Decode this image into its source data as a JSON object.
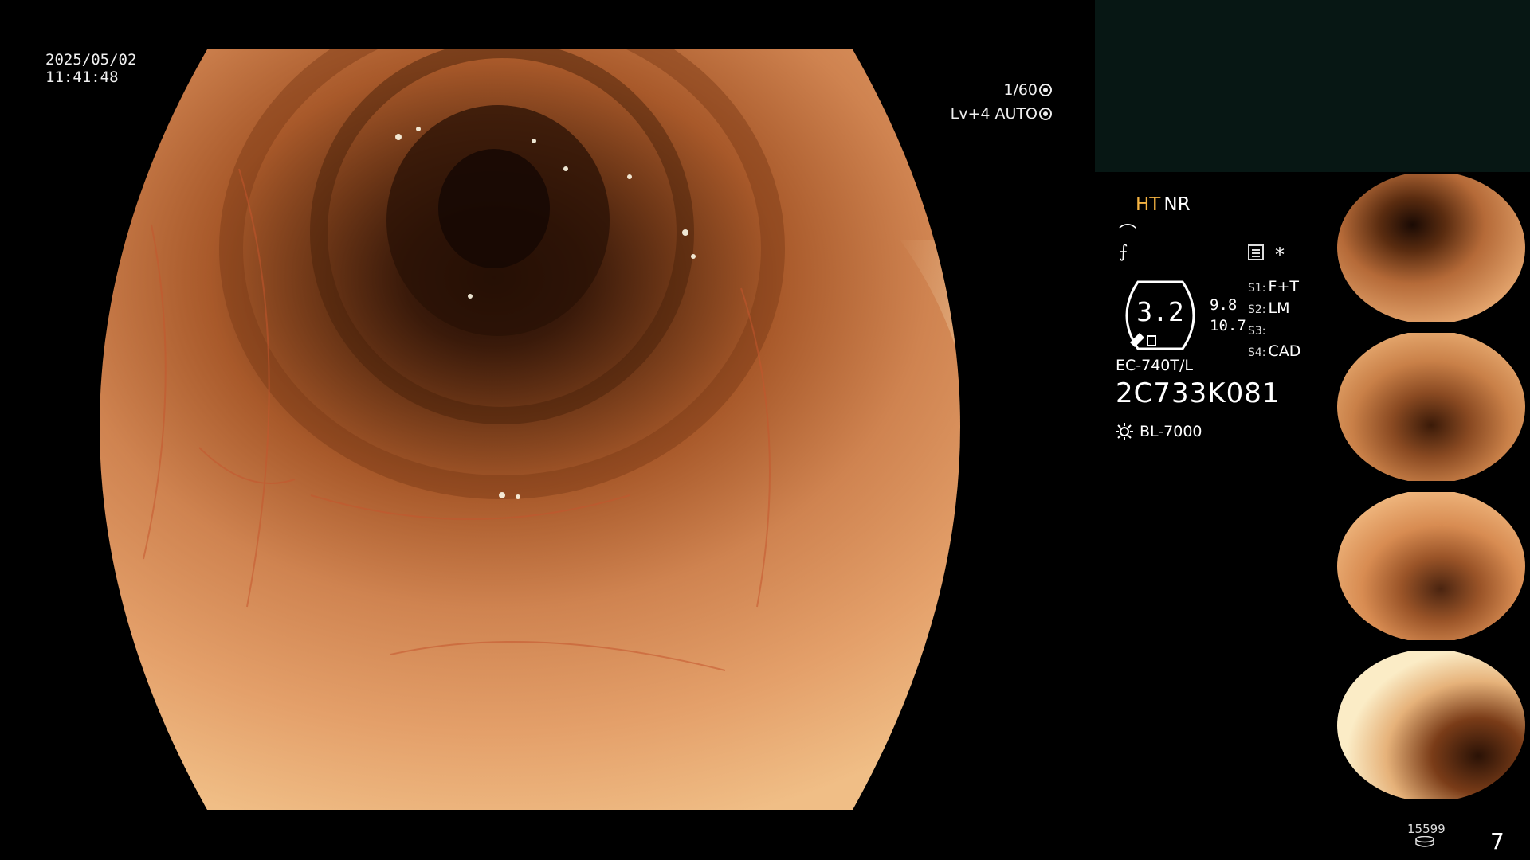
{
  "header": {
    "date": "2025/05/02",
    "time": "11:41:48"
  },
  "exposure": {
    "shutter": "1/60",
    "level": "Lv+4",
    "mode": "AUTO"
  },
  "info": {
    "enhance_ht": "HT",
    "enhance_nr": "NR",
    "main_value": "3.2",
    "sub_value_1": "9.8",
    "sub_value_2": "10.7",
    "asterisk": "*",
    "slots": [
      {
        "key": "S1:",
        "value": "F+T"
      },
      {
        "key": "S2:",
        "value": "LM"
      },
      {
        "key": "S3:",
        "value": ""
      },
      {
        "key": "S4:",
        "value": "CAD"
      }
    ],
    "scope_model": "EC-740T/L",
    "scope_serial": "2C733K081",
    "light_source": "BL-7000"
  },
  "icons": [
    "shutter-icon",
    "auto-iris-icon",
    "structure-enhance-icon",
    "freeze-icon",
    "memo-icon",
    "light-source-icon",
    "storage-disk-icon"
  ],
  "footer": {
    "image_count": "15599",
    "page": "7"
  },
  "colors": {
    "ht_accent": "#f5b342",
    "panel_bg": "#071714"
  }
}
